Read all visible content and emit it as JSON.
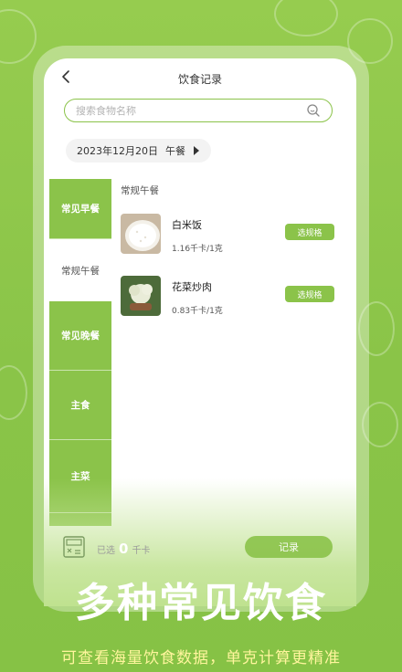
{
  "header": {
    "title": "饮食记录"
  },
  "search": {
    "placeholder": "搜索食物名称"
  },
  "date": {
    "text": "2023年12月20日",
    "meal": "午餐"
  },
  "sidebar": {
    "items": [
      {
        "label": "常见早餐"
      },
      {
        "label": "常规午餐"
      },
      {
        "label": "常见晚餐"
      },
      {
        "label": "主食"
      },
      {
        "label": "主菜"
      }
    ]
  },
  "section": {
    "title": "常规午餐"
  },
  "foods": [
    {
      "name": "白米饭",
      "calories": "1.16千卡",
      "unit": "/1克",
      "button": "选规格"
    },
    {
      "name": "花菜炒肉",
      "calories": "0.83千卡",
      "unit": "/1克",
      "button": "选规格"
    }
  ],
  "bottom": {
    "selected_prefix": "已选",
    "selected_count": "0",
    "selected_unit": "千卡",
    "record_label": "记录"
  },
  "promo": {
    "headline": "多种常见饮食",
    "subline": "可查看海量饮食数据，单克计算更精准"
  },
  "colors": {
    "accent": "#8bc34a",
    "subline": "#fff59d"
  }
}
